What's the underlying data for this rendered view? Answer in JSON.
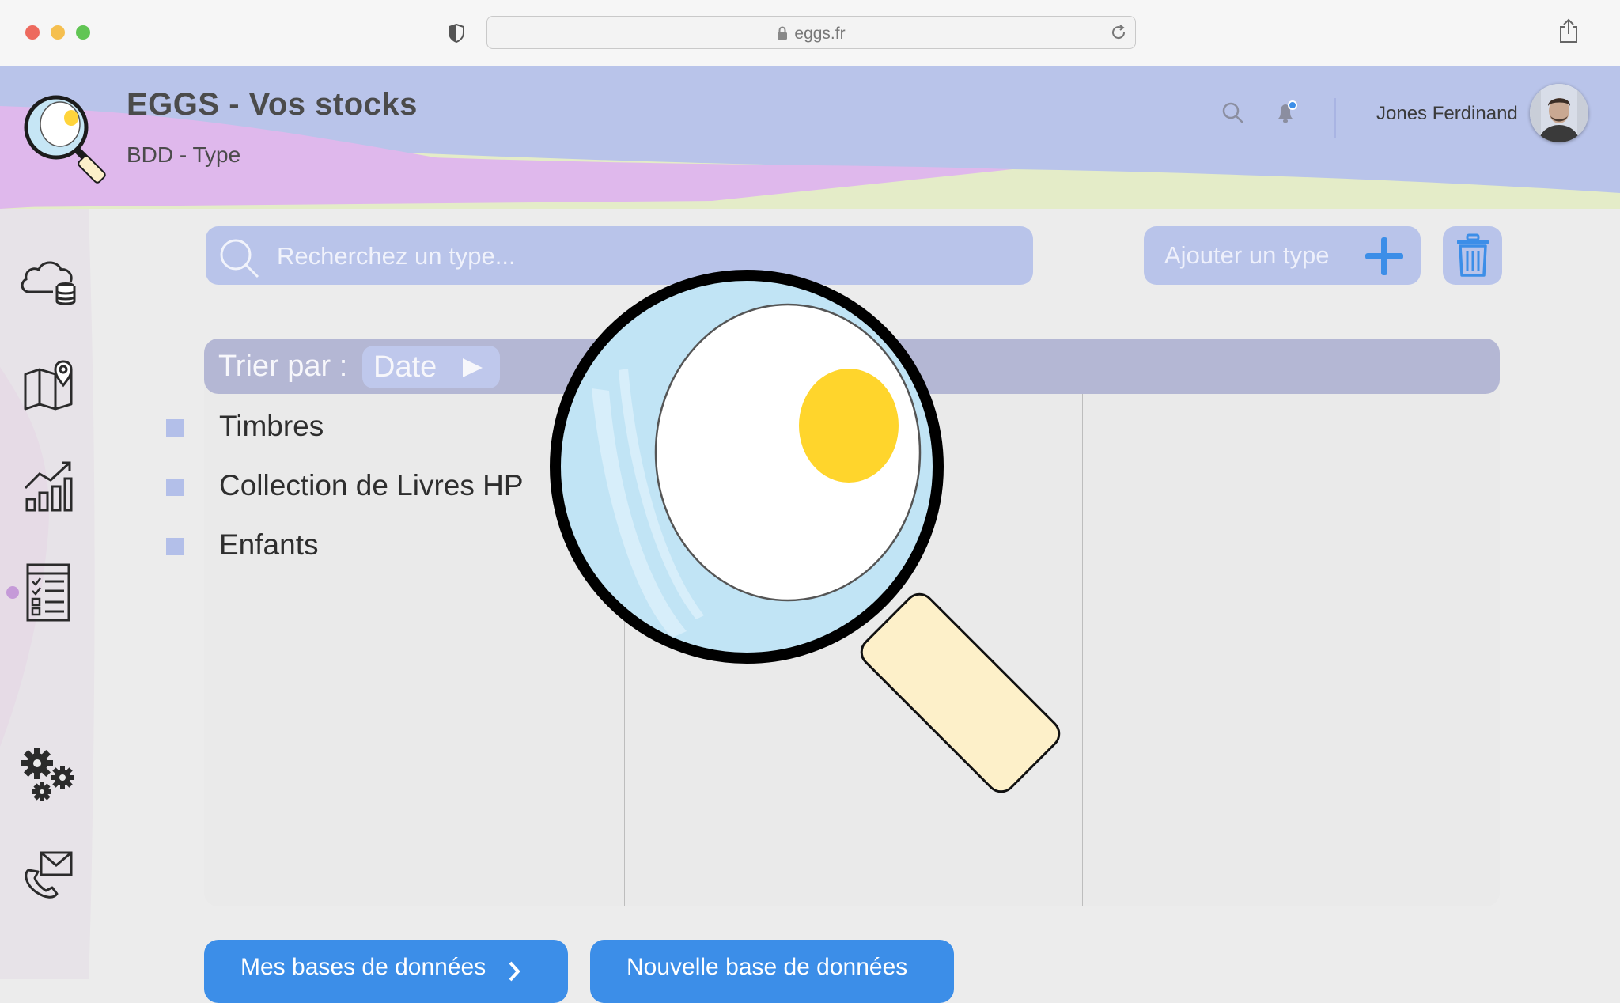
{
  "browser": {
    "url": "eggs.fr"
  },
  "header": {
    "title": "EGGS - Vos stocks",
    "subtitle": "BDD - Type",
    "user_name": "Jones Ferdinand"
  },
  "sidebar": {
    "items": [
      {
        "icon": "cloud-database-icon"
      },
      {
        "icon": "map-pin-icon"
      },
      {
        "icon": "analytics-chart-icon"
      },
      {
        "icon": "checklist-table-icon",
        "active": true
      },
      {
        "icon": "gears-icon"
      },
      {
        "icon": "phone-mail-icon"
      }
    ]
  },
  "toolbar": {
    "search_placeholder": "Recherchez un type...",
    "add_label": "Ajouter un type"
  },
  "sort": {
    "label": "Trier par :",
    "value": "Date"
  },
  "types": [
    {
      "label": "Timbres"
    },
    {
      "label": "Collection de Livres HP"
    },
    {
      "label": "Enfants"
    }
  ],
  "footer": {
    "my_databases_label": "Mes bases de données",
    "new_database_label": "Nouvelle base de données"
  },
  "colors": {
    "accent": "#3c8ee8",
    "header_blue": "#b9c4ea",
    "header_pink": "#dfb8ec",
    "sort_bar": "#b4b7d4"
  }
}
